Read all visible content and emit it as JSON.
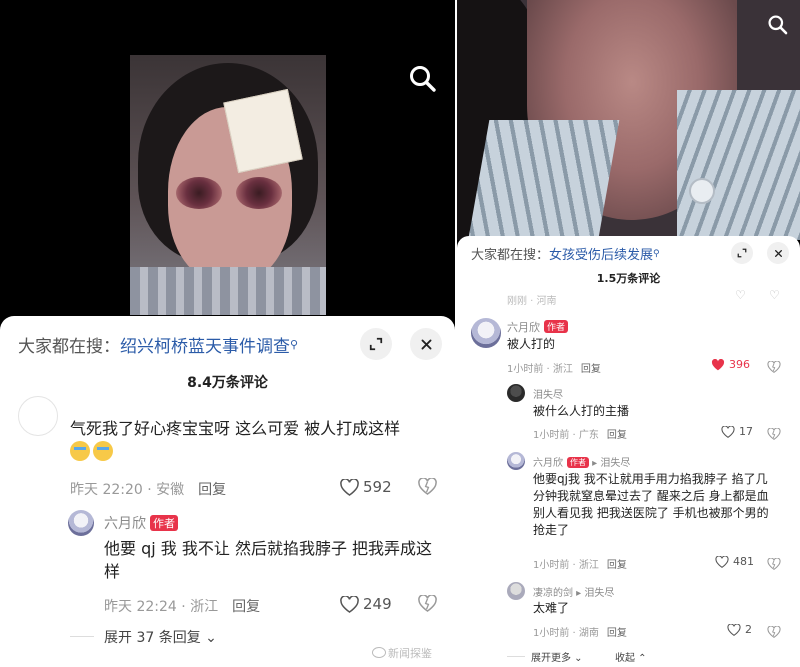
{
  "left": {
    "search": {
      "prefix": "大家都在搜：",
      "query": "绍兴柯桥蓝天事件调查"
    },
    "comment_count": "8.4万条评论",
    "comments": [
      {
        "user": "",
        "text": "气死我了好心疼宝宝呀 这么可爱 被人打成这样",
        "emojis": [
          "loudly-crying-emoji",
          "loudly-crying-emoji"
        ],
        "time": "昨天 22:20 · 安徽",
        "reply": "回复",
        "likes": "592"
      },
      {
        "user": "六月欣",
        "badge": "作者",
        "text": "他要 qj 我 我不让 然后就掐我脖子 把我弄成这样",
        "time": "昨天 22:24 · 浙江",
        "reply": "回复",
        "likes": "249"
      }
    ],
    "expand": "展开 37 条回复"
  },
  "right": {
    "search": {
      "prefix": "大家都在搜：",
      "query": "女孩受伤后续发展"
    },
    "comment_count": "1.5万条评论",
    "ghost_meta": "刚刚 · 河南",
    "comments": [
      {
        "user": "六月欣",
        "badge": "作者",
        "text": "被人打的",
        "time": "1小时前 · 浙江",
        "reply": "回复",
        "likes": "396",
        "liked": true
      },
      {
        "user": "泪失尽",
        "text": "被什么人打的主播",
        "time": "1小时前 · 广东",
        "reply": "回复",
        "likes": "17"
      },
      {
        "user": "六月欣",
        "badge": "作者",
        "reply_to": "泪失尽",
        "text": "他要qj我 我不让就用手用力掐我脖子 掐了几分钟我就窒息晕过去了 醒来之后 身上都是血 别人看见我 把我送医院了 手机也被那个男的抢走了",
        "time": "1小时前 · 浙江",
        "reply": "回复",
        "likes": "481"
      },
      {
        "user": "凄凉的剑",
        "reply_to": "泪失尽",
        "text": "太难了",
        "time": "1小时前 · 湖南",
        "reply": "回复",
        "likes": "2"
      }
    ],
    "expand_more": "展开更多",
    "collapse": "收起"
  },
  "watermark": "新闻探鉴",
  "colors": {
    "link": "#2b5ba8",
    "author_badge": "#e8334a",
    "liked": "#e8334a"
  },
  "icons": [
    "search-icon",
    "expand-icon",
    "close-icon",
    "heart-icon",
    "dislike-icon",
    "chevron-down-icon",
    "chevron-up-icon",
    "reply-arrow-icon"
  ]
}
